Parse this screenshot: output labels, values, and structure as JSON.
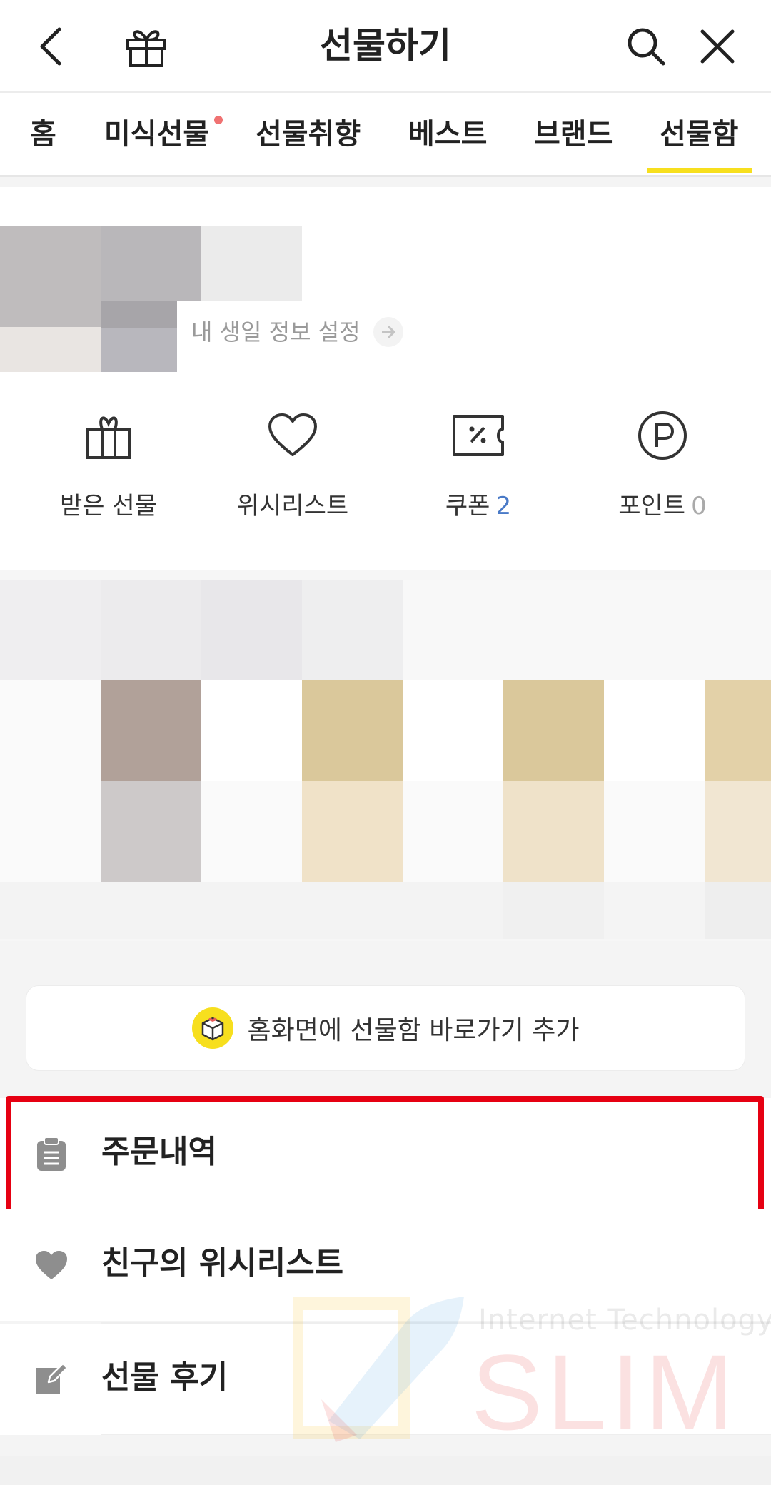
{
  "header": {
    "title": "선물하기",
    "back_icon": "back-arrow-icon",
    "gift_icon": "gift-icon",
    "search_icon": "search-icon",
    "close_icon": "close-icon"
  },
  "tabs": [
    {
      "label": "홈"
    },
    {
      "label": "미식선물",
      "has_dot": true
    },
    {
      "label": "선물취향"
    },
    {
      "label": "베스트"
    },
    {
      "label": "브랜드"
    },
    {
      "label": "선물함",
      "active": true
    }
  ],
  "profile": {
    "birthday_link": "내 생일 정보 설정"
  },
  "quick_menu": [
    {
      "icon": "gift-box-icon",
      "label": "받은 선물"
    },
    {
      "icon": "heart-outline-icon",
      "label": "위시리스트"
    },
    {
      "icon": "coupon-icon",
      "label": "쿠폰",
      "count": "2"
    },
    {
      "icon": "point-icon",
      "label": "포인트",
      "count": "0"
    }
  ],
  "shortcut": {
    "label": "홈화면에 선물함 바로가기 추가",
    "icon": "gift-box-shortcut-icon"
  },
  "menu": [
    {
      "icon": "clipboard-icon",
      "label": "주문내역",
      "highlighted": true
    },
    {
      "icon": "heart-filled-icon",
      "label": "친구의 위시리스트"
    },
    {
      "icon": "edit-icon",
      "label": "선물 후기"
    }
  ],
  "watermark": {
    "subtitle": "Internet Technology",
    "title": "SLIM"
  },
  "colors": {
    "accent_yellow": "#f7df1e",
    "highlight_red": "#e60012",
    "count_blue": "#4a7ac7",
    "notification_dot": "#f07272"
  }
}
